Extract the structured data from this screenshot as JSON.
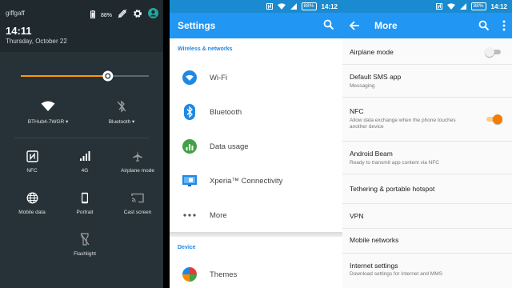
{
  "quick_settings": {
    "carrier": "giffgaff",
    "battery": "88%",
    "time": "14:11",
    "date": "Thursday, October 22",
    "brightness_level": 0.68,
    "tiles": [
      {
        "label": "BTHub4-7WGR",
        "icon": "wifi-icon",
        "dropdown": true
      },
      {
        "label": "Bluetooth",
        "icon": "bluetooth-off-icon",
        "dropdown": true
      },
      {
        "label": "NFC",
        "icon": "nfc-icon"
      },
      {
        "label": "4G",
        "icon": "signal-bars-icon"
      },
      {
        "label": "Airplane mode",
        "icon": "airplane-icon"
      },
      {
        "label": "Mobile data",
        "icon": "globe-icon"
      },
      {
        "label": "Portrait",
        "icon": "phone-portrait-icon"
      },
      {
        "label": "Cast screen",
        "icon": "cast-icon"
      },
      {
        "label": "Flashlight",
        "icon": "flashlight-icon"
      }
    ],
    "accent": "#ff9800"
  },
  "settings": {
    "time": "14:12",
    "battery": "88%",
    "title": "Settings",
    "section_wireless": "Wireless & networks",
    "items": [
      {
        "label": "Wi-Fi",
        "icon": "wifi-icon"
      },
      {
        "label": "Bluetooth",
        "icon": "bluetooth-icon"
      },
      {
        "label": "Data usage",
        "icon": "data-usage-icon"
      },
      {
        "label": "Xperia™ Connectivity",
        "icon": "xperia-connectivity-icon"
      },
      {
        "label": "More",
        "icon": "more-dots-icon"
      }
    ],
    "section_device": "Device",
    "device_items": [
      {
        "label": "Themes",
        "icon": "themes-icon"
      }
    ],
    "accent": "#2196f3"
  },
  "more": {
    "time": "14:12",
    "battery": "88%",
    "title": "More",
    "rows": [
      {
        "title": "Airplane mode",
        "subtitle": "",
        "toggle": "off"
      },
      {
        "title": "Default SMS app",
        "subtitle": "Messaging"
      },
      {
        "title": "NFC",
        "subtitle": "Allow data exchange when the phone touches another device",
        "toggle": "on"
      },
      {
        "title": "Android Beam",
        "subtitle": "Ready to transmit app content via NFC"
      },
      {
        "title": "Tethering & portable hotspot",
        "subtitle": ""
      },
      {
        "title": "VPN",
        "subtitle": ""
      },
      {
        "title": "Mobile networks",
        "subtitle": ""
      },
      {
        "title": "Internet settings",
        "subtitle": "Download settings for Internet and MMS"
      }
    ],
    "toggle_on_color": "#f57c00"
  }
}
